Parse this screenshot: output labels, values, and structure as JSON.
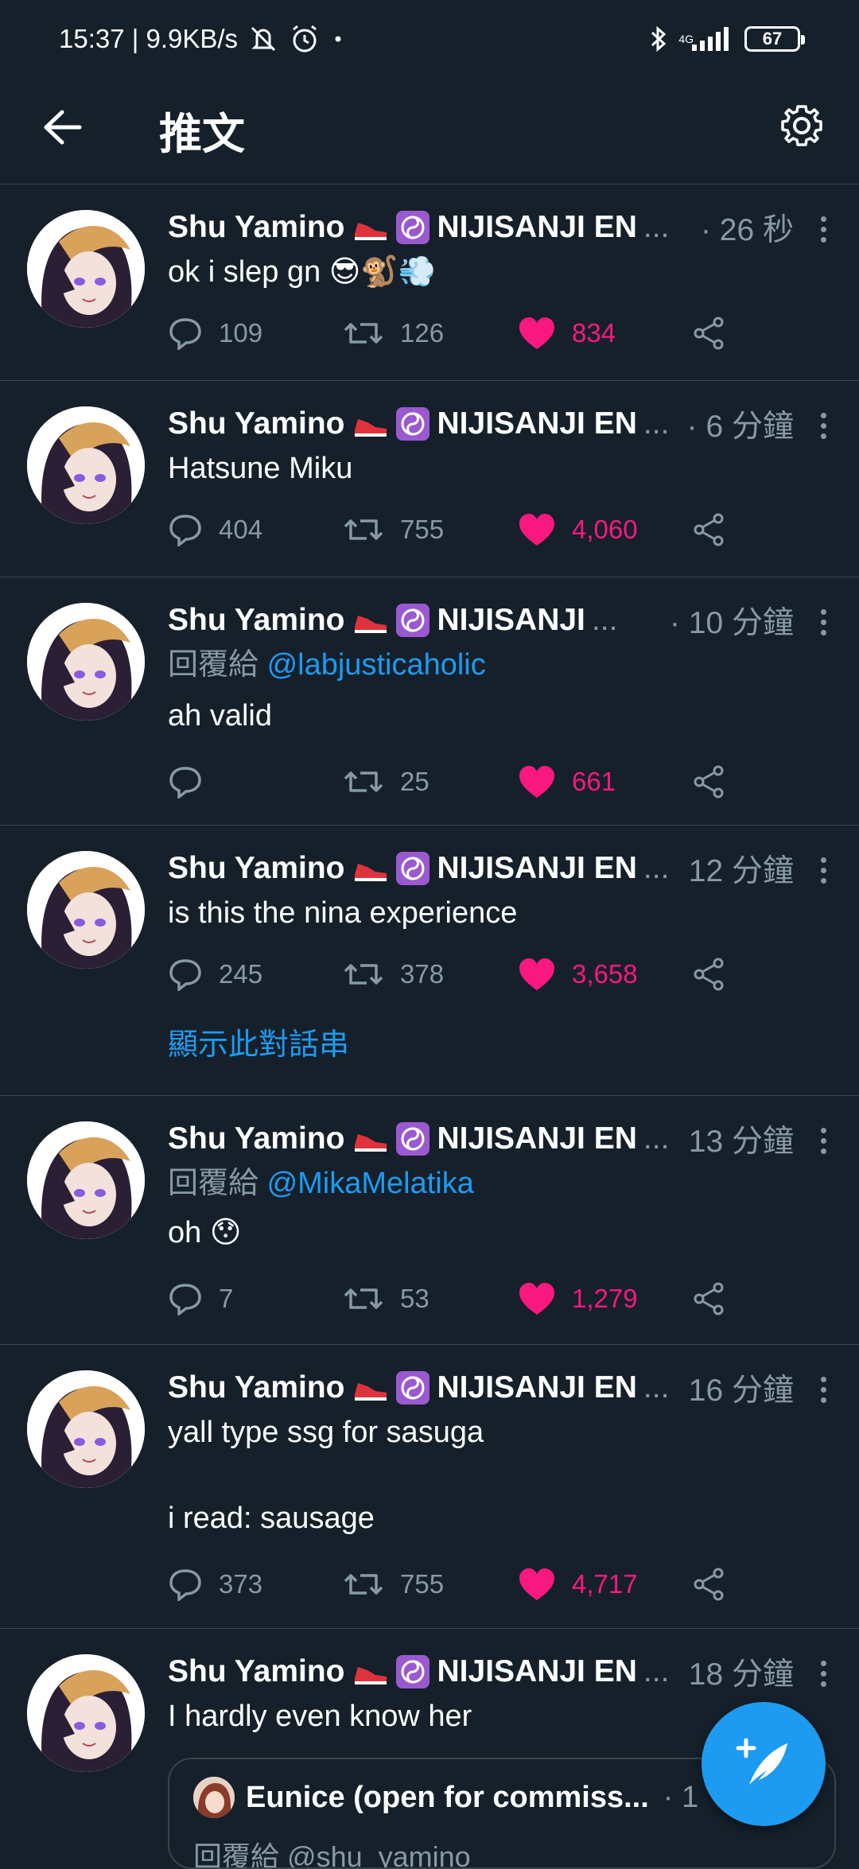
{
  "status_bar": {
    "time": "15:37 | 9.9KB/s",
    "network_type": "4G",
    "battery": "67"
  },
  "header": {
    "title": "推文"
  },
  "tweets": [
    {
      "name": "Shu Yamino",
      "affiliation": "NIJISANJI EN",
      "ellipsis": "...",
      "time": "· 26 秒",
      "text": "ok i slep gn 😎🐒💨",
      "replies": "109",
      "retweets": "126",
      "likes": "834"
    },
    {
      "name": "Shu Yamino",
      "affiliation": "NIJISANJI EN",
      "ellipsis": "...",
      "time": "· 6 分鐘",
      "text": "Hatsune Miku",
      "replies": "404",
      "retweets": "755",
      "likes": "4,060"
    },
    {
      "name": "Shu Yamino",
      "affiliation": "NIJISANJI",
      "ellipsis": "...",
      "time": "· 10 分鐘",
      "reply_prefix": "回覆給",
      "reply_mention": "@labjusticaholic",
      "text": "ah valid",
      "replies": "",
      "retweets": "25",
      "likes": "661"
    },
    {
      "name": "Shu Yamino",
      "affiliation": "NIJISANJI EN",
      "ellipsis": "...",
      "time": "12 分鐘",
      "text": "is this the nina experience",
      "replies": "245",
      "retweets": "378",
      "likes": "3,658",
      "thread_link": "顯示此對話串"
    },
    {
      "name": "Shu Yamino",
      "affiliation": "NIJISANJI EN",
      "ellipsis": "...",
      "time": "13 分鐘",
      "reply_prefix": "回覆給",
      "reply_mention": "@MikaMelatika",
      "text": "oh 😯",
      "replies": "7",
      "retweets": "53",
      "likes": "1,279"
    },
    {
      "name": "Shu Yamino",
      "affiliation": "NIJISANJI EN",
      "ellipsis": "...",
      "time": "16 分鐘",
      "text_line1": "yall type ssg for sasuga",
      "text_line2": "i read: sausage",
      "replies": "373",
      "retweets": "755",
      "likes": "4,717"
    },
    {
      "name": "Shu Yamino",
      "affiliation": "NIJISANJI EN",
      "ellipsis": "...",
      "time": "18 分鐘",
      "text": "I hardly even know her",
      "quote": {
        "name": "Eunice (open for commiss...",
        "time": "· 1",
        "reply_prefix": "回覆給",
        "reply_mention": "@shu_yamino"
      }
    }
  ],
  "colors": {
    "background": "#15202b",
    "divider": "#38444d",
    "muted": "#8899a6",
    "like": "#f91880",
    "accent": "#1d9bf0"
  }
}
